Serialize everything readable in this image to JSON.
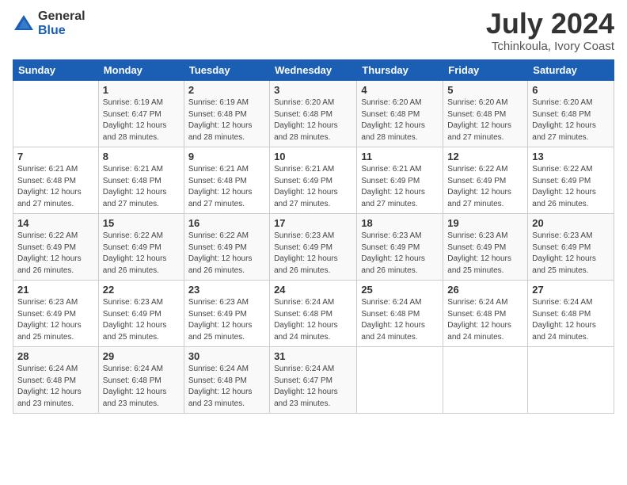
{
  "header": {
    "logo_general": "General",
    "logo_blue": "Blue",
    "month_year": "July 2024",
    "location": "Tchinkoula, Ivory Coast"
  },
  "days_of_week": [
    "Sunday",
    "Monday",
    "Tuesday",
    "Wednesday",
    "Thursday",
    "Friday",
    "Saturday"
  ],
  "weeks": [
    [
      {
        "day": "",
        "info": ""
      },
      {
        "day": "1",
        "info": "Sunrise: 6:19 AM\nSunset: 6:47 PM\nDaylight: 12 hours\nand 28 minutes."
      },
      {
        "day": "2",
        "info": "Sunrise: 6:19 AM\nSunset: 6:48 PM\nDaylight: 12 hours\nand 28 minutes."
      },
      {
        "day": "3",
        "info": "Sunrise: 6:20 AM\nSunset: 6:48 PM\nDaylight: 12 hours\nand 28 minutes."
      },
      {
        "day": "4",
        "info": "Sunrise: 6:20 AM\nSunset: 6:48 PM\nDaylight: 12 hours\nand 28 minutes."
      },
      {
        "day": "5",
        "info": "Sunrise: 6:20 AM\nSunset: 6:48 PM\nDaylight: 12 hours\nand 27 minutes."
      },
      {
        "day": "6",
        "info": "Sunrise: 6:20 AM\nSunset: 6:48 PM\nDaylight: 12 hours\nand 27 minutes."
      }
    ],
    [
      {
        "day": "7",
        "info": "Sunrise: 6:21 AM\nSunset: 6:48 PM\nDaylight: 12 hours\nand 27 minutes."
      },
      {
        "day": "8",
        "info": "Sunrise: 6:21 AM\nSunset: 6:48 PM\nDaylight: 12 hours\nand 27 minutes."
      },
      {
        "day": "9",
        "info": "Sunrise: 6:21 AM\nSunset: 6:48 PM\nDaylight: 12 hours\nand 27 minutes."
      },
      {
        "day": "10",
        "info": "Sunrise: 6:21 AM\nSunset: 6:49 PM\nDaylight: 12 hours\nand 27 minutes."
      },
      {
        "day": "11",
        "info": "Sunrise: 6:21 AM\nSunset: 6:49 PM\nDaylight: 12 hours\nand 27 minutes."
      },
      {
        "day": "12",
        "info": "Sunrise: 6:22 AM\nSunset: 6:49 PM\nDaylight: 12 hours\nand 27 minutes."
      },
      {
        "day": "13",
        "info": "Sunrise: 6:22 AM\nSunset: 6:49 PM\nDaylight: 12 hours\nand 26 minutes."
      }
    ],
    [
      {
        "day": "14",
        "info": "Sunrise: 6:22 AM\nSunset: 6:49 PM\nDaylight: 12 hours\nand 26 minutes."
      },
      {
        "day": "15",
        "info": "Sunrise: 6:22 AM\nSunset: 6:49 PM\nDaylight: 12 hours\nand 26 minutes."
      },
      {
        "day": "16",
        "info": "Sunrise: 6:22 AM\nSunset: 6:49 PM\nDaylight: 12 hours\nand 26 minutes."
      },
      {
        "day": "17",
        "info": "Sunrise: 6:23 AM\nSunset: 6:49 PM\nDaylight: 12 hours\nand 26 minutes."
      },
      {
        "day": "18",
        "info": "Sunrise: 6:23 AM\nSunset: 6:49 PM\nDaylight: 12 hours\nand 26 minutes."
      },
      {
        "day": "19",
        "info": "Sunrise: 6:23 AM\nSunset: 6:49 PM\nDaylight: 12 hours\nand 25 minutes."
      },
      {
        "day": "20",
        "info": "Sunrise: 6:23 AM\nSunset: 6:49 PM\nDaylight: 12 hours\nand 25 minutes."
      }
    ],
    [
      {
        "day": "21",
        "info": "Sunrise: 6:23 AM\nSunset: 6:49 PM\nDaylight: 12 hours\nand 25 minutes."
      },
      {
        "day": "22",
        "info": "Sunrise: 6:23 AM\nSunset: 6:49 PM\nDaylight: 12 hours\nand 25 minutes."
      },
      {
        "day": "23",
        "info": "Sunrise: 6:23 AM\nSunset: 6:49 PM\nDaylight: 12 hours\nand 25 minutes."
      },
      {
        "day": "24",
        "info": "Sunrise: 6:24 AM\nSunset: 6:48 PM\nDaylight: 12 hours\nand 24 minutes."
      },
      {
        "day": "25",
        "info": "Sunrise: 6:24 AM\nSunset: 6:48 PM\nDaylight: 12 hours\nand 24 minutes."
      },
      {
        "day": "26",
        "info": "Sunrise: 6:24 AM\nSunset: 6:48 PM\nDaylight: 12 hours\nand 24 minutes."
      },
      {
        "day": "27",
        "info": "Sunrise: 6:24 AM\nSunset: 6:48 PM\nDaylight: 12 hours\nand 24 minutes."
      }
    ],
    [
      {
        "day": "28",
        "info": "Sunrise: 6:24 AM\nSunset: 6:48 PM\nDaylight: 12 hours\nand 23 minutes."
      },
      {
        "day": "29",
        "info": "Sunrise: 6:24 AM\nSunset: 6:48 PM\nDaylight: 12 hours\nand 23 minutes."
      },
      {
        "day": "30",
        "info": "Sunrise: 6:24 AM\nSunset: 6:48 PM\nDaylight: 12 hours\nand 23 minutes."
      },
      {
        "day": "31",
        "info": "Sunrise: 6:24 AM\nSunset: 6:47 PM\nDaylight: 12 hours\nand 23 minutes."
      },
      {
        "day": "",
        "info": ""
      },
      {
        "day": "",
        "info": ""
      },
      {
        "day": "",
        "info": ""
      }
    ]
  ]
}
